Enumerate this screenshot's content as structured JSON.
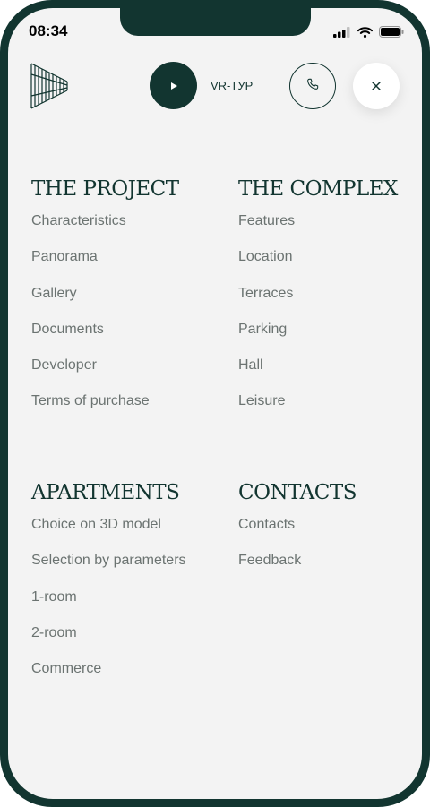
{
  "status_bar": {
    "time": "08:34"
  },
  "header": {
    "logo_icon": "building-logo-icon",
    "play_icon": "play-icon",
    "vr_label": "VR-ТУР",
    "phone_icon": "phone-icon",
    "close_icon": "close-icon"
  },
  "menu": {
    "sections": [
      {
        "title": "THE PROJECT",
        "items": [
          "Characteristics",
          "Panorama",
          "Gallery",
          "Documents",
          "Developer",
          "Terms of purchase"
        ]
      },
      {
        "title": "THE COMPLEX",
        "items": [
          "Features",
          "Location",
          "Terraces",
          "Parking",
          "Hall",
          "Leisure"
        ]
      },
      {
        "title": "APARTMENTS",
        "items": [
          "Choice on 3D model",
          "Selection by parameters",
          "1-room",
          "2-room",
          "Commerce"
        ]
      },
      {
        "title": "CONTACTS",
        "items": [
          "Contacts",
          "Feedback"
        ]
      }
    ]
  },
  "colors": {
    "frame": "#123530",
    "screen_bg": "#f3f3f3",
    "accent": "#123530",
    "link": "#6b7371"
  }
}
